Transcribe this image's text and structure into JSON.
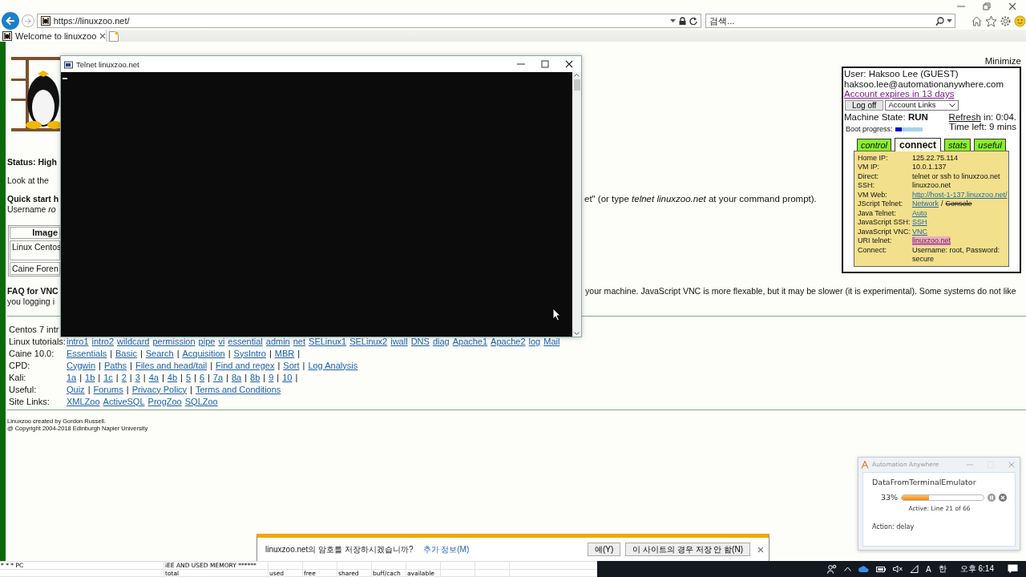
{
  "browser": {
    "address": "https://linuxzoo.net/",
    "search_placeholder": "검색...",
    "tabs": [
      {
        "label": "Welcome to linuxzoo",
        "selected": true
      }
    ]
  },
  "page": {
    "minimize": "Minimize",
    "status": "Status: High",
    "look": "Look at the",
    "quick_start": "Quick start h",
    "username": "Username *ro*",
    "quick_start_right": "et\" (or type *telnet linuxzoo.net* at your command prompt).",
    "images_table": {
      "header": "Image",
      "rows": [
        "Linux Centos",
        "Caine Foren"
      ]
    },
    "faq_title": "FAQ for VNC",
    "faq_left": "you logging i",
    "faq_right": "your machine. JavaScript VNC is more flexable, but it may be slower (it is experimental). Some systems do not like",
    "link_rows": [
      {
        "label": "Centos 7 intr",
        "links": []
      },
      {
        "label": "Linux tutorials:",
        "links": [
          "intro1",
          "intro2",
          "wildcard",
          "permission",
          "pipe",
          "vi",
          "essential",
          "admin",
          "net",
          "SELinux1",
          "SELinux2",
          "iwall",
          "DNS",
          "diag",
          "Apache1",
          "Apache2",
          "log",
          "Mail"
        ]
      },
      {
        "label": "Caine 10.0:",
        "links": [
          "Essentials",
          "Basic",
          "Search",
          "Acquisition",
          "SysIntro",
          "MBR"
        ],
        "separator": "|",
        "trailing": true
      },
      {
        "label": "CPD:",
        "links": [
          "Cygwin",
          "Paths",
          "Files and head/tail",
          "Find and regex",
          "Sort",
          "Log Analysis"
        ],
        "separator": "|",
        "trailing": false
      },
      {
        "label": "Kali:",
        "links": [
          "1a",
          "1b",
          "1c",
          "2",
          "3",
          "4a",
          "4b",
          "5",
          "6",
          "7a",
          "8a",
          "8b",
          "9",
          "10"
        ],
        "separator": "|",
        "trailing": true
      },
      {
        "label": "Useful:",
        "links": [
          "Quiz",
          "Forums",
          "Privacy Policy",
          "Terms and Conditions"
        ],
        "separator": "|",
        "trailing": false
      },
      {
        "label": "Site Links:",
        "links": [
          "XMLZoo",
          "ActiveSQL",
          "ProgZoo",
          "SQLZoo"
        ]
      }
    ],
    "footer": [
      "Linuxzoo created by Gordon Russell.",
      "@ Copyright 2004-2018 Edinburgh Napier University"
    ]
  },
  "panel": {
    "user": "User: Haksoo Lee (GUEST)",
    "email": "haksoo.lee@automationanywhere.com",
    "expiry": "Account expires in 13 days",
    "logoff": "Log off",
    "account_select": "Account Links",
    "machine_state": "Machine State: **RUN**",
    "refresh_link": "Refresh",
    "refresh_text": "in: 0:04.",
    "time_left": "Time left: 9 mins",
    "boot": {
      "label": "Boot progress:",
      "level": 0.25
    },
    "tabs": [
      {
        "label": "control",
        "selected": false
      },
      {
        "label": "connect",
        "selected": true
      },
      {
        "label": "stats",
        "selected": false
      },
      {
        "label": "useful",
        "selected": false
      }
    ],
    "info": [
      {
        "label": "Home IP:",
        "parts": [
          {
            "kind": "text",
            "text": "125.22.75.114"
          }
        ]
      },
      {
        "label": "VM IP:",
        "parts": [
          {
            "kind": "text",
            "text": "10.0.1.137"
          }
        ]
      },
      {
        "label": "Direct:",
        "parts": [
          {
            "kind": "text",
            "text": "telnet or ssh to linuxzoo.net"
          }
        ]
      },
      {
        "label": "SSH:",
        "parts": [
          {
            "kind": "text",
            "text": "linuxzoo.net"
          }
        ]
      },
      {
        "label": "VM Web:",
        "parts": [
          {
            "kind": "link",
            "text": "http://host-1-137.linuxzoo.net/"
          }
        ]
      },
      {
        "label": "JScript Telnet:",
        "parts": [
          {
            "kind": "link",
            "text": "Network"
          },
          {
            "kind": "text",
            "text": "/"
          },
          {
            "kind": "struck",
            "text": "Console"
          }
        ]
      },
      {
        "label": "Java Telnet:",
        "parts": [
          {
            "kind": "link",
            "text": "Auto"
          }
        ]
      },
      {
        "label": "JavaScript SSH:",
        "parts": [
          {
            "kind": "link",
            "text": "SSH"
          }
        ]
      },
      {
        "label": "JavaScript VNC:",
        "parts": [
          {
            "kind": "link",
            "text": "VNC"
          }
        ]
      },
      {
        "label": "URI telnet:",
        "parts": [
          {
            "kind": "visited",
            "text": "linuxzoo.net"
          }
        ]
      },
      {
        "label": "Connect:",
        "parts": [
          {
            "kind": "text",
            "text": "Username: root, Password: secure"
          }
        ]
      }
    ]
  },
  "telnet": {
    "title": "Telnet linuxzoo.net"
  },
  "save_bar": {
    "message": "linuxzoo.net의 암호를 저장하시겠습니까?",
    "more_info": "추가 정보(M)",
    "buttons": [
      "예(Y)",
      "이 사이트의 경우 저장 안 함(N)"
    ]
  },
  "automation": {
    "title": "Automation Anywhere",
    "task": "DataFromTerminalEmulator",
    "percent": "33%",
    "level": 0.33,
    "active": "Active: Line 21 of 66",
    "action": "Action: delay"
  },
  "sheet": {
    "rows": [
      [
        "* * * PC",
        "iEE AND USED MEMORY ******"
      ],
      [
        "",
        "total",
        "used",
        "free",
        "shared",
        "buff/cach",
        "available"
      ]
    ]
  },
  "taskbar": {
    "ime": "A",
    "language": "한",
    "clock": "오후 6:14"
  }
}
